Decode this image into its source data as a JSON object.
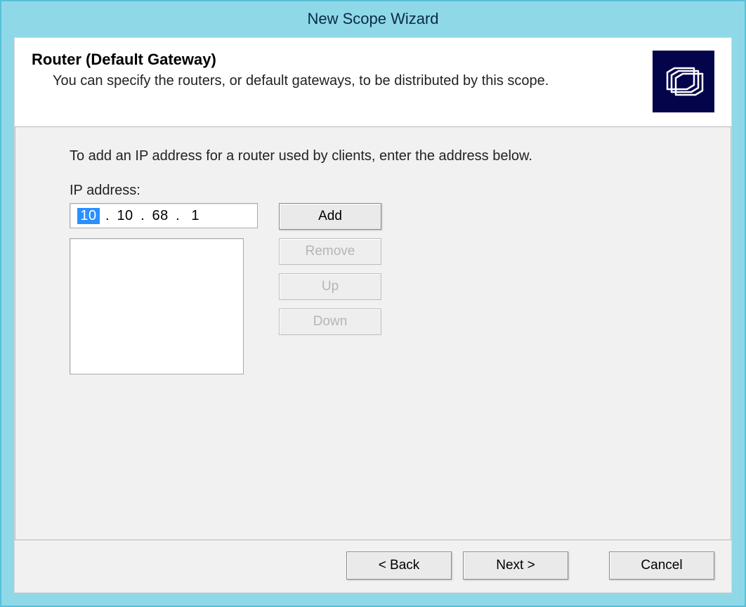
{
  "window": {
    "title": "New Scope Wizard"
  },
  "header": {
    "title": "Router (Default Gateway)",
    "subtitle": "You can specify the routers, or default gateways, to be distributed by this scope.",
    "icon_name": "folder-icon"
  },
  "body": {
    "instructions": "To add an IP address for a router used by clients, enter the address below.",
    "ip_label": "IP address:",
    "ip_value": {
      "oct1": "10",
      "oct2": "10",
      "oct3": "68",
      "oct4": "1"
    },
    "ip_list": [],
    "buttons": {
      "add": "Add",
      "remove": "Remove",
      "up": "Up",
      "down": "Down"
    }
  },
  "footer": {
    "back": "< Back",
    "next": "Next >",
    "cancel": "Cancel"
  }
}
